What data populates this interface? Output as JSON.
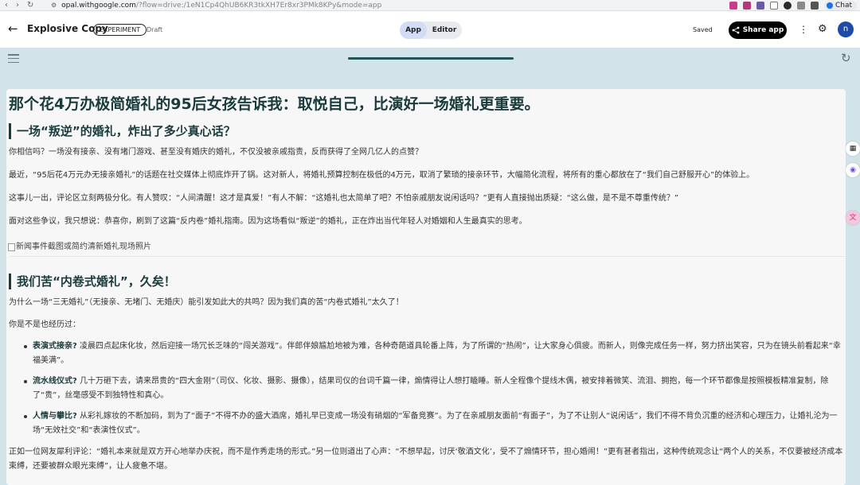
{
  "browser": {
    "url_host": "opal.withgoogle.com",
    "url_path": "/?flow=drive:/1eN1Cp4QhUB6KR3tkXH7Er8xr3PMk8KPy&mode=app",
    "chat_label": "Chat"
  },
  "header": {
    "app_title": "Explosive Copy",
    "badge": "EXPERIMENT",
    "status": "Draft",
    "tab_app": "App",
    "tab_editor": "Editor",
    "saved": "Saved",
    "share_label": "Share app",
    "avatar_initial": "n"
  },
  "article": {
    "title": "那个花4万办极简婚礼的95后女孩告诉我：取悦自己，比演好一场婚礼更重要。",
    "section1": {
      "heading": "一场“叛逆”的婚礼，炸出了多少真心话？",
      "p1": "你相信吗？一场没有接亲、没有堵门游戏、甚至没有婚庆的婚礼，不仅没被亲戚指责，反而获得了全网几亿人的点赞？",
      "p2": "最近，“95后花4万元办无接亲婚礼”的话题在社交媒体上彻底炸开了锅。这对新人，将婚礼预算控制在极低的4万元，取消了繁琐的接亲环节，大幅简化流程，将所有的重心都放在了“我们自己舒服开心”的体验上。",
      "p3": "这事儿一出，评论区立刻两极分化。有人赞叹：“人间清醒！这才是真爱！”有人不解：“这婚礼也太简单了吧？不怕亲戚朋友说闲话吗？”更有人直接抛出质疑：“这么做，是不是不尊重传统？”",
      "p4": "面对这些争议，我只想说：恭喜你，刷到了这篇“反内卷”婚礼指南。因为这场看似“叛逆”的婚礼，正在炸出当代年轻人对婚姻和人生最真实的思考。",
      "image_alt": "新闻事件截图或简约清新婚礼现场照片"
    },
    "section2": {
      "heading": "我们苦“内卷式婚礼”，久矣！",
      "p1": "为什么一场“三无婚礼”（无接亲、无堵门、无婚庆）能引发如此大的共鸣？因为我们真的苦“内卷式婚礼”太久了！",
      "p2": "你是不是也经历过：",
      "bullets": [
        {
          "term": "表演式接亲?",
          "text": "凌晨四点起床化妆，然后迎接一场冗长乏味的“闯关游戏”。伴郎伴娘尴尬地被为难，各种奇葩道具轮番上阵，为了所谓的“热闹”，让大家身心俱疲。而新人，则像完成任务一样，努力挤出笑容，只为在镜头前看起来“幸福美满”。"
        },
        {
          "term": "流水线仪式?",
          "text": "几十万砸下去，请来昂贵的“四大金刚”（司仪、化妆、摄影、摄像），结果司仪的台词千篇一律，煽情得让人想打瞌睡。新人全程像个提线木偶，被安排着微笑、流泪、拥抱，每一个环节都像是按照模板精准复制，除了“贵”，丝毫感受不到独特性和真心。"
        },
        {
          "term": "人情与攀比?",
          "text": "从彩礼嫁妆的不断加码，到为了“面子”不得不办的盛大酒席，婚礼早已变成一场没有硝烟的“军备竞赛”。为了在亲戚朋友面前“有面子”，为了不让别人“说闲话”，我们不得不背负沉重的经济和心理压力，让婚礼沦为一场“无效社交”和“表演性仪式”。"
        }
      ],
      "p3": "正如一位网友犀利评论：“婚礼本来就是双方开心地举办庆祝，而不是作秀走场的形式。”另一位则道出了心声：“不想早起，讨厌‘敬酒文化’，受不了煽情环节，担心婚闹！”更有甚者指出，这种传统观念让“两个人的关系，不仅要被经济成本束缚，还要被群众眼光束缚”，让人疲惫不堪。"
    }
  },
  "colors": {
    "teal_bg": "#d2e3ea",
    "accent_dark": "#1a3b3d",
    "progress": "#1f5559",
    "avatar": "#1e4aa8"
  }
}
